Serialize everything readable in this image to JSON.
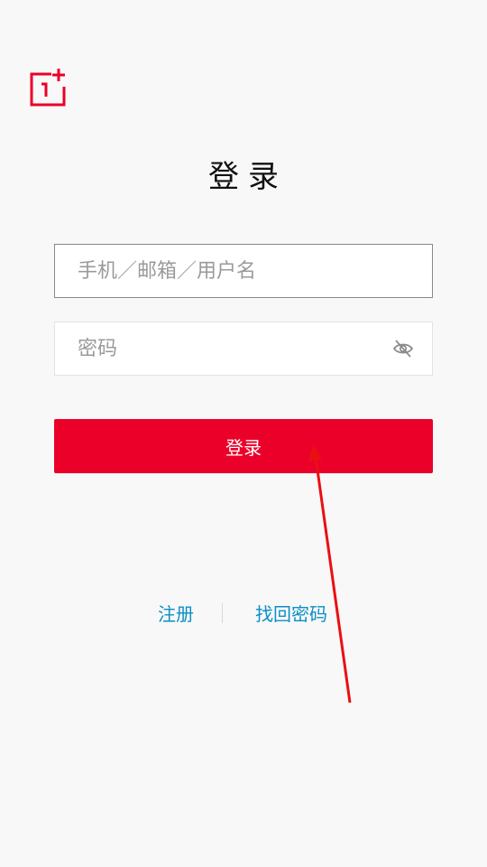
{
  "app": {
    "brand_color": "#eb0029",
    "link_color": "#0a8fc6",
    "logo": "oneplus-logo"
  },
  "login": {
    "title": "登录",
    "username_placeholder": "手机／邮箱／用户名",
    "password_placeholder": "密码",
    "password_toggle_icon": "eye-hidden-icon",
    "submit_label": "登录"
  },
  "links": {
    "register": "注册",
    "divider": "|",
    "recover_password": "找回密码"
  }
}
